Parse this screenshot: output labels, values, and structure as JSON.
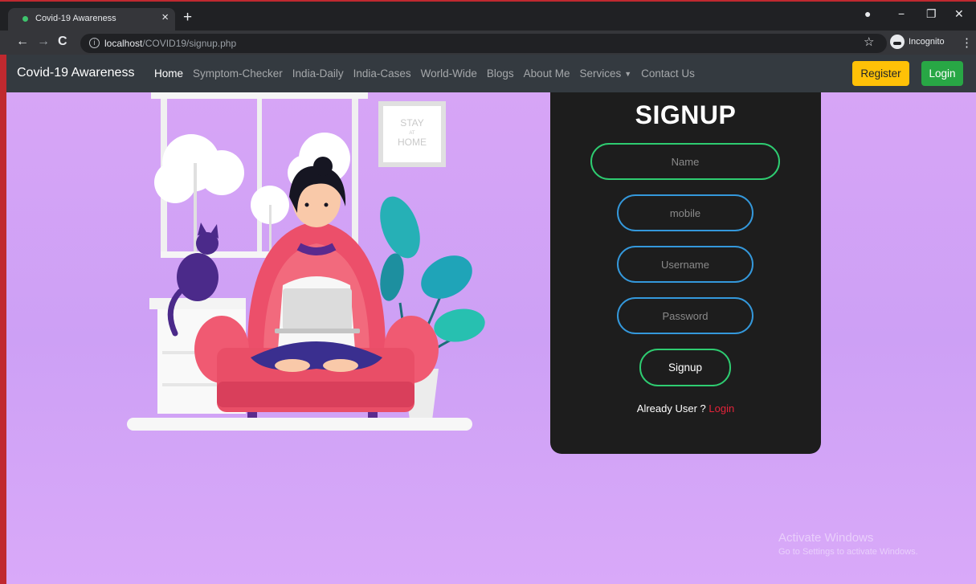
{
  "browser": {
    "tab_title": "Covid-19 Awareness",
    "url_host": "localhost",
    "url_path": "/COVID19/signup.php",
    "incognito_label": "Incognito"
  },
  "navbar": {
    "brand": "Covid-19 Awareness",
    "links": [
      "Home",
      "Symptom-Checker",
      "India-Daily",
      "India-Cases",
      "World-Wide",
      "Blogs",
      "About Me",
      "Services",
      "Contact Us"
    ],
    "active_link": "Home",
    "register_label": "Register",
    "login_label": "Login",
    "colors": {
      "register": "#ffc107",
      "login": "#28a745",
      "bar": "#343a40"
    }
  },
  "illustration": {
    "poster_line1": "STAY",
    "poster_line2": "AT",
    "poster_line3": "HOME"
  },
  "signup": {
    "title": "SIGNUP",
    "name_placeholder": "Name",
    "mobile_placeholder": "mobile",
    "username_placeholder": "Username",
    "password_placeholder": "Password",
    "submit_label": "Signup",
    "already_text": "Already User ?",
    "login_link": "Login",
    "colors": {
      "card": "#1d1d1d",
      "green": "#2ecc71",
      "blue": "#3498db",
      "link": "#e4233a"
    }
  },
  "watermark": {
    "title": "Activate Windows",
    "subtitle": "Go to Settings to activate Windows."
  },
  "page": {
    "background": "#d2a3f6"
  }
}
